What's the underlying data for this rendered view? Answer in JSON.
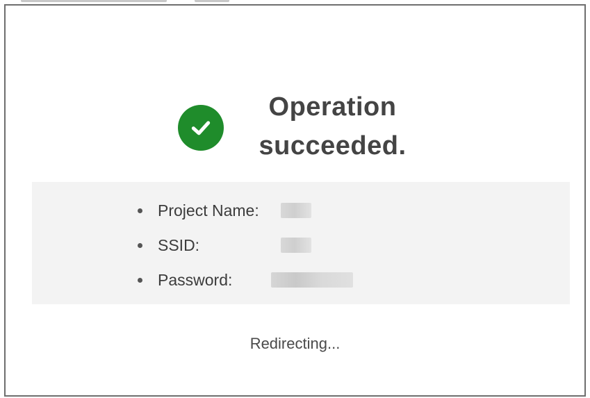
{
  "dialog": {
    "title": "Operation succeeded.",
    "icon": "check-circle-icon",
    "accent_color": "#1f8c2b",
    "details": [
      {
        "label": "Project Name:",
        "value": "",
        "redacted": true
      },
      {
        "label": "SSID:",
        "value": "",
        "redacted": true
      },
      {
        "label": "Password:",
        "value": "",
        "redacted": true
      }
    ],
    "status": "Redirecting..."
  }
}
